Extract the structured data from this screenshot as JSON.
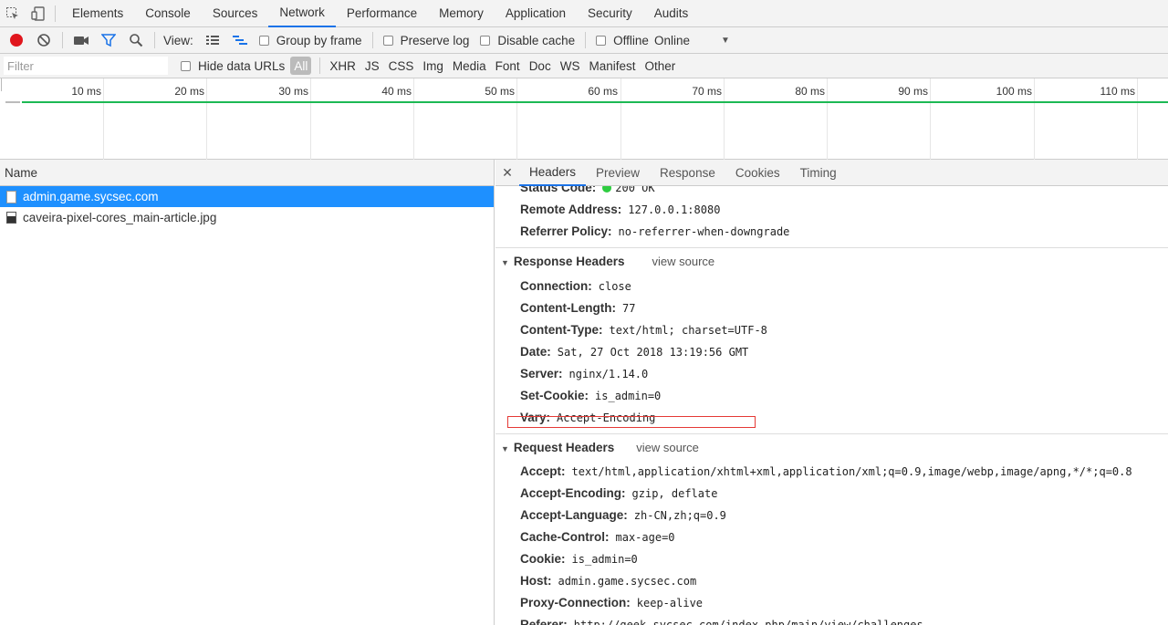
{
  "tabs": {
    "items": [
      {
        "label": "Elements",
        "active": false
      },
      {
        "label": "Console",
        "active": false
      },
      {
        "label": "Sources",
        "active": false
      },
      {
        "label": "Network",
        "active": true
      },
      {
        "label": "Performance",
        "active": false
      },
      {
        "label": "Memory",
        "active": false
      },
      {
        "label": "Application",
        "active": false
      },
      {
        "label": "Security",
        "active": false
      },
      {
        "label": "Audits",
        "active": false
      }
    ]
  },
  "toolbar": {
    "view_label": "View:",
    "group_by_frame": "Group by frame",
    "preserve_log": "Preserve log",
    "disable_cache": "Disable cache",
    "offline": "Offline",
    "throttle_value": "Online"
  },
  "filterbar": {
    "placeholder": "Filter",
    "hide_data_urls": "Hide data URLs",
    "types": [
      "All",
      "XHR",
      "JS",
      "CSS",
      "Img",
      "Media",
      "Font",
      "Doc",
      "WS",
      "Manifest",
      "Other"
    ]
  },
  "overview": {
    "ticks": [
      "10 ms",
      "20 ms",
      "30 ms",
      "40 ms",
      "50 ms",
      "60 ms",
      "70 ms",
      "80 ms",
      "90 ms",
      "100 ms",
      "110 ms"
    ]
  },
  "requests": {
    "header": "Name",
    "rows": [
      {
        "name": "admin.game.sycsec.com",
        "selected": true
      },
      {
        "name": "caveira-pixel-cores_main-article.jpg",
        "selected": false
      }
    ]
  },
  "detail": {
    "tabs": [
      "Headers",
      "Preview",
      "Response",
      "Cookies",
      "Timing"
    ],
    "general": {
      "status_code_key": "Status Code:",
      "status_code_val": "200 OK",
      "remote_key": "Remote Address:",
      "remote_val": "127.0.0.1:8080",
      "referrer_policy_key": "Referrer Policy:",
      "referrer_policy_val": "no-referrer-when-downgrade"
    },
    "response_headers": {
      "title": "Response Headers",
      "view_source": "view source",
      "items": [
        {
          "k": "Connection:",
          "v": "close"
        },
        {
          "k": "Content-Length:",
          "v": "77"
        },
        {
          "k": "Content-Type:",
          "v": "text/html; charset=UTF-8"
        },
        {
          "k": "Date:",
          "v": "Sat, 27 Oct 2018 13:19:56 GMT"
        },
        {
          "k": "Server:",
          "v": "nginx/1.14.0"
        },
        {
          "k": "Set-Cookie:",
          "v": "is_admin=0"
        },
        {
          "k": "Vary:",
          "v": "Accept-Encoding"
        }
      ]
    },
    "request_headers": {
      "title": "Request Headers",
      "view_source": "view source",
      "items": [
        {
          "k": "Accept:",
          "v": "text/html,application/xhtml+xml,application/xml;q=0.9,image/webp,image/apng,*/*;q=0.8"
        },
        {
          "k": "Accept-Encoding:",
          "v": "gzip, deflate"
        },
        {
          "k": "Accept-Language:",
          "v": "zh-CN,zh;q=0.9"
        },
        {
          "k": "Cache-Control:",
          "v": "max-age=0"
        },
        {
          "k": "Cookie:",
          "v": "is_admin=0"
        },
        {
          "k": "Host:",
          "v": "admin.game.sycsec.com"
        },
        {
          "k": "Proxy-Connection:",
          "v": "keep-alive"
        },
        {
          "k": "Referer:",
          "v": "http://geek.sycsec.com/index.php/main/view/challenges"
        }
      ]
    }
  },
  "colors": {
    "accent": "#1a73e8",
    "selected_row": "#1e90ff",
    "record": "#e0161d",
    "status_ok": "#2ecc40",
    "highlight": "#e53935"
  }
}
